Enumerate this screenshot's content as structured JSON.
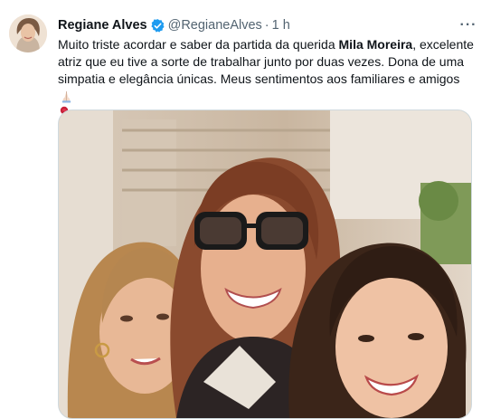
{
  "tweet": {
    "author_name": "Regiane Alves",
    "author_handle": "@RegianeAlves",
    "separator": "·",
    "time": "1 h",
    "more_label": "···",
    "text_part1": "Muito triste acordar e saber da partida da querida ",
    "text_bold": "Mila Moreira",
    "text_part2": ", excelente atriz que eu tive a sorte de trabalhar junto por duas vezes. Dona de uma simpatia e elegância únicas. Meus sentimentos aos familiares e amigos ",
    "emoji_icons": [
      "folded-hands-icon",
      "rose-icon"
    ]
  },
  "colors": {
    "text": "#0f1419",
    "secondary": "#536471",
    "verified_blue": "#1d9bf0",
    "border": "#cfd9de"
  }
}
